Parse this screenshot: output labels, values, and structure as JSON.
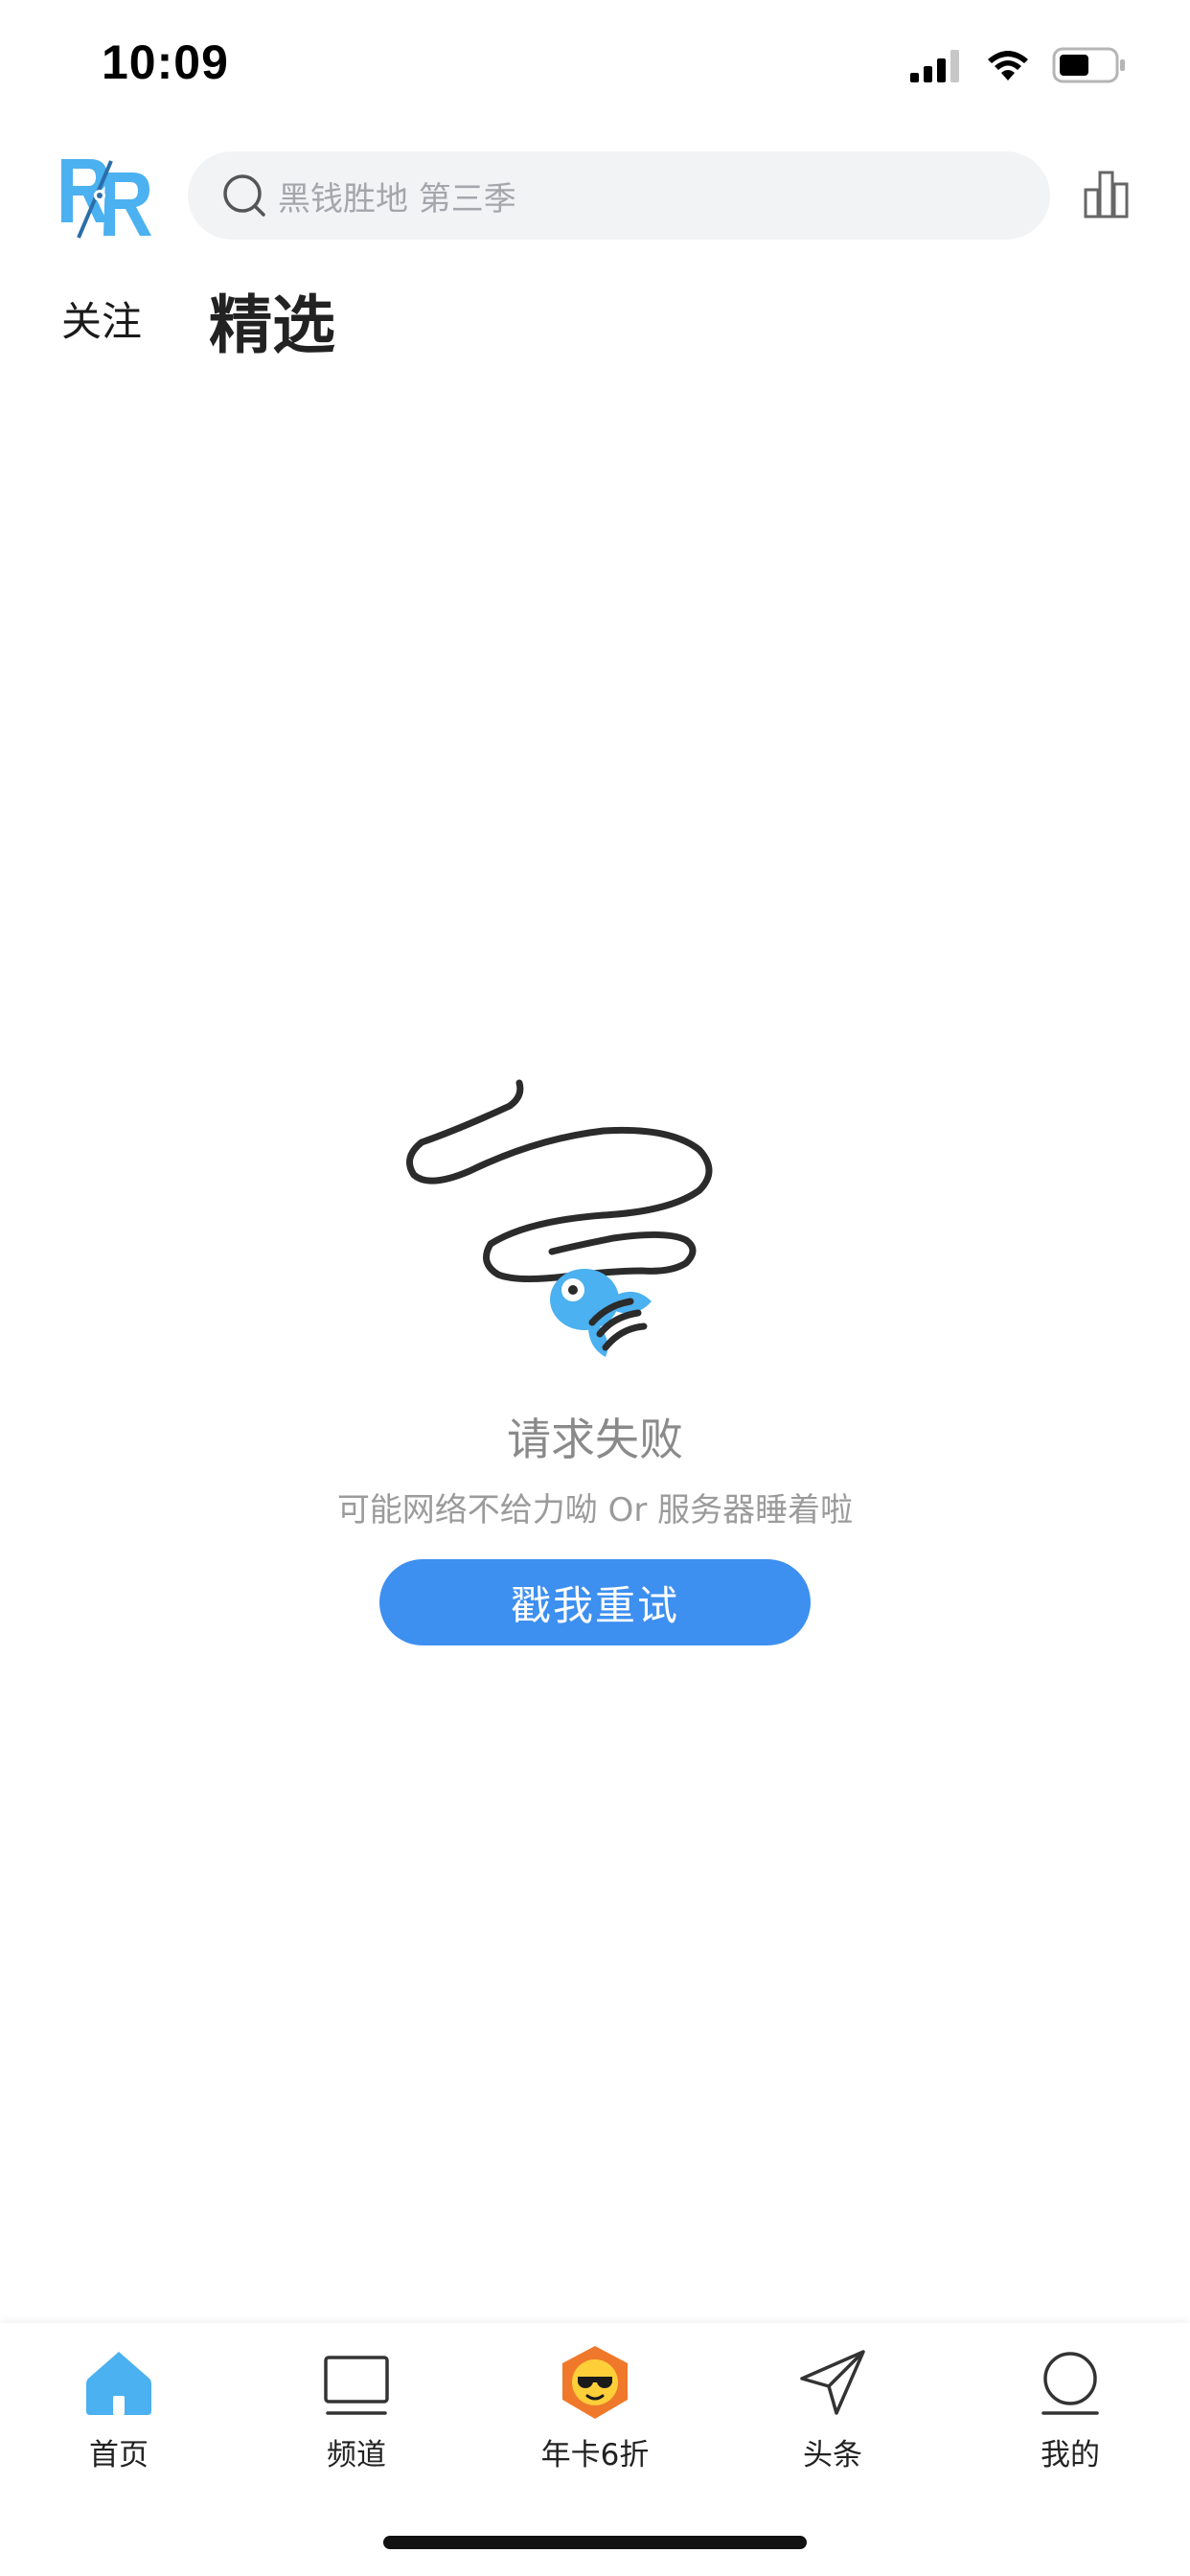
{
  "status_bar": {
    "time": "10:09"
  },
  "header": {
    "logo_name": "rr-logo",
    "search": {
      "placeholder": "黑钱胜地 第三季"
    }
  },
  "tabs": {
    "follow": "关注",
    "featured": "精选"
  },
  "error": {
    "title": "请求失败",
    "subtitle": "可能网络不给力呦 Or 服务器睡着啦",
    "retry": "戳我重试"
  },
  "tabbar": {
    "items": [
      {
        "label": "首页",
        "icon": "home-icon"
      },
      {
        "label": "频道",
        "icon": "tv-icon"
      },
      {
        "label": "年卡6折",
        "icon": "promo-badge-icon"
      },
      {
        "label": "头条",
        "icon": "paper-plane-icon"
      },
      {
        "label": "我的",
        "icon": "profile-icon"
      }
    ]
  },
  "colors": {
    "accent": "#3d8ff0",
    "logo_blue": "#4bb1f0",
    "search_bg": "#f2f3f5",
    "muted_text": "#8a8a8a",
    "promo_orange": "#f0782a"
  }
}
